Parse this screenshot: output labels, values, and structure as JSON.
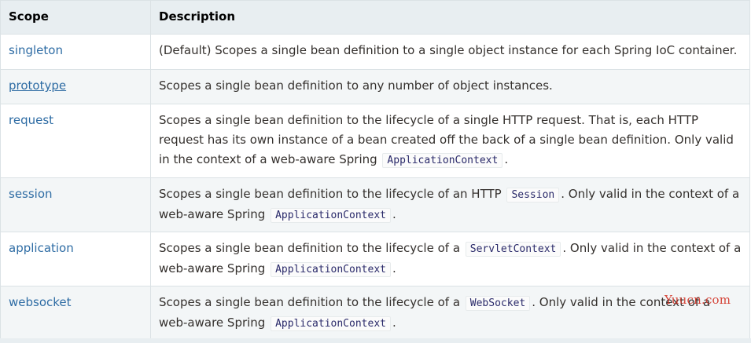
{
  "table": {
    "headers": {
      "scope": "Scope",
      "description": "Description"
    },
    "rows": [
      {
        "scope": "singleton",
        "desc": {
          "t1": "(Default) Scopes a single bean definition to a single object instance for each Spring IoC container."
        }
      },
      {
        "scope": "prototype",
        "desc": {
          "t1": "Scopes a single bean definition to any number of object instances."
        }
      },
      {
        "scope": "request",
        "desc": {
          "t1": "Scopes a single bean definition to the lifecycle of a single HTTP request. That is, each HTTP request has its own instance of a bean created off the back of a single bean definition. Only valid in the context of a web-aware Spring ",
          "code1": "ApplicationContext",
          "t2": "."
        }
      },
      {
        "scope": "session",
        "desc": {
          "t1": "Scopes a single bean definition to the lifecycle of an HTTP ",
          "code1": "Session",
          "t2": ". Only valid in the context of a web-aware Spring ",
          "code2": "ApplicationContext",
          "t3": "."
        }
      },
      {
        "scope": "application",
        "desc": {
          "t1": "Scopes a single bean definition to the lifecycle of a ",
          "code1": "ServletContext",
          "t2": ". Only valid in the context of a web-aware Spring ",
          "code2": "ApplicationContext",
          "t3": "."
        }
      },
      {
        "scope": "websocket",
        "desc": {
          "t1": "Scopes a single bean definition to the lifecycle of a ",
          "code1": "WebSocket",
          "t2": ". Only valid in the context of a web-aware Spring ",
          "code2": "ApplicationContext",
          "t3": "."
        }
      }
    ]
  },
  "watermark": "Yuucn.com",
  "colors": {
    "link": "#2e6ca4",
    "header_bg": "#e8eef1",
    "stripe_bg": "#f3f6f7",
    "border": "#dbe2e5",
    "watermark": "#d0281a"
  }
}
